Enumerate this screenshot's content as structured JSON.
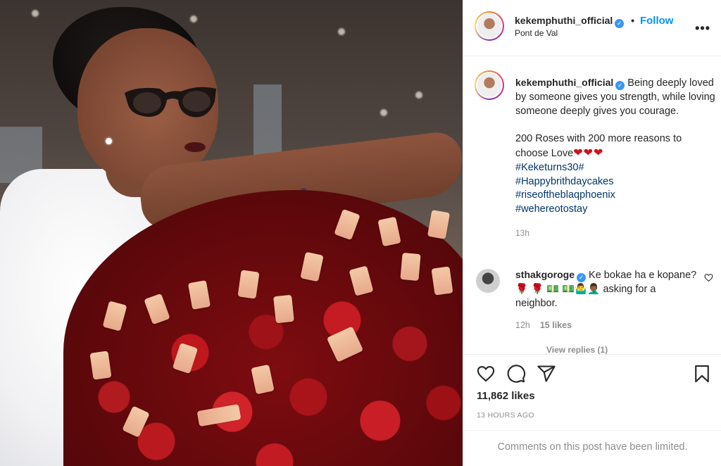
{
  "post": {
    "username": "kekemphuthi_official",
    "follow_label": "Follow",
    "separator": "•",
    "location": "Pont de Val",
    "more_label": "•••"
  },
  "caption": {
    "username": "kekemphuthi_official",
    "text_line1": "Being deeply loved by someone gives you strength, while loving someone deeply gives you courage.",
    "text_line2": "200 Roses with 200 more reasons to choose Love",
    "hearts": "❤❤❤",
    "hashtags": [
      "#Keketurns30#",
      "#Happybrithdaycakes",
      "#riseoftheblaqphoenix",
      "#wehereotostay"
    ],
    "time": "13h"
  },
  "comment": {
    "username": "sthakgoroge",
    "text": "Ke bokae ha e kopane?🌹 🌹 💵 💵🤷‍♂️🤦🏾‍♂️ asking for a neighbor.",
    "time": "12h",
    "likes": "15 likes",
    "view_replies": "View replies (1)"
  },
  "actions": {
    "likes": "11,862 likes",
    "timestamp": "13 HOURS AGO",
    "limited_notice": "Comments on this post have been limited."
  },
  "colors": {
    "link_blue": "#0095f6",
    "hashtag": "#00376b",
    "verified": "#3897f0",
    "muted": "#8e8e8e"
  }
}
